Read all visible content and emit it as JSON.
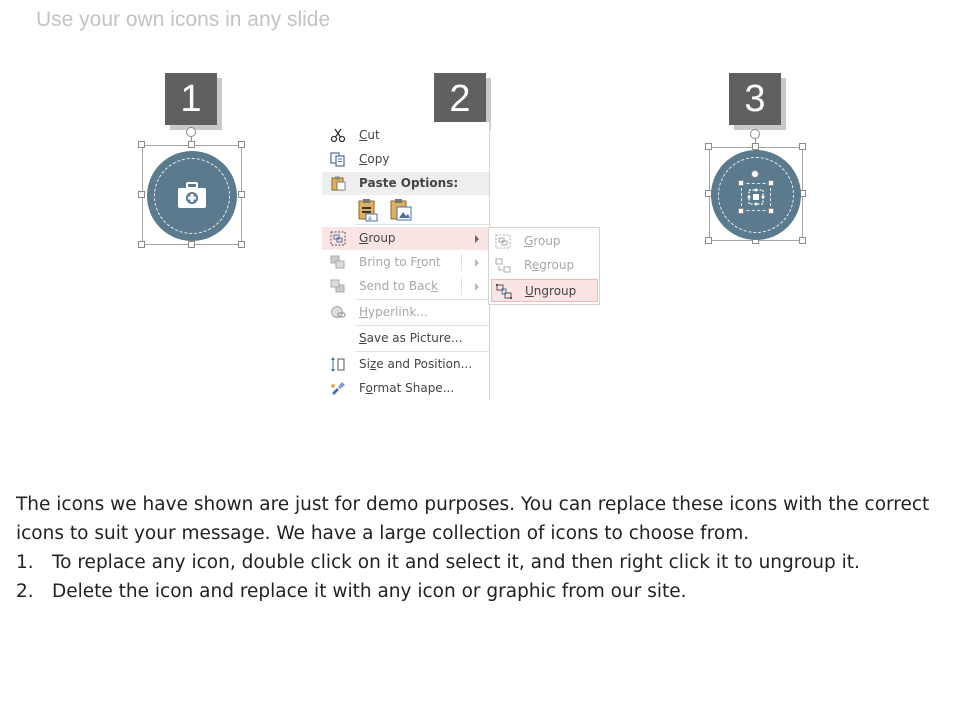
{
  "slide": {
    "title": "Use your own icons in any slide"
  },
  "steps": [
    {
      "number": "1"
    },
    {
      "number": "2"
    },
    {
      "number": "3"
    }
  ],
  "context_menu": {
    "items": [
      {
        "key": "cut",
        "label_pre": "",
        "label_u": "C",
        "label_post": "ut",
        "icon": "scissors-icon"
      },
      {
        "key": "copy",
        "label_pre": "",
        "label_u": "C",
        "label_post": "opy",
        "icon": "copy-icon"
      },
      {
        "key": "paste_options",
        "label": "Paste Options:",
        "icon": "clipboard-icon"
      },
      {
        "key": "group",
        "label_pre": "",
        "label_u": "G",
        "label_post": "roup",
        "icon": "group-icon"
      },
      {
        "key": "bring_to_front",
        "label_pre": "Bring to F",
        "label_u": "r",
        "label_post": "ont",
        "icon": "bring-to-front-icon"
      },
      {
        "key": "send_to_back",
        "label_pre": "Send to Bac",
        "label_u": "k",
        "label_post": "",
        "icon": "send-to-back-icon"
      },
      {
        "key": "hyperlink",
        "label_pre": "",
        "label_u": "H",
        "label_post": "yperlink...",
        "icon": "hyperlink-icon"
      },
      {
        "key": "save_as_picture",
        "label_pre": "",
        "label_u": "S",
        "label_post": "ave as Picture...",
        "icon": ""
      },
      {
        "key": "size_and_position",
        "label_pre": "Si",
        "label_u": "z",
        "label_post": "e and Position...",
        "icon": "size-position-icon"
      },
      {
        "key": "format_shape",
        "label_pre": "F",
        "label_u": "o",
        "label_post": "rmat Shape...",
        "icon": "format-shape-icon"
      }
    ]
  },
  "submenu": {
    "items": [
      {
        "key": "group",
        "label_pre": "",
        "label_u": "G",
        "label_post": "roup"
      },
      {
        "key": "regroup",
        "label_pre": "R",
        "label_u": "e",
        "label_post": "group"
      },
      {
        "key": "ungroup",
        "label_pre": "",
        "label_u": "U",
        "label_post": "ngroup"
      }
    ]
  },
  "instructions": {
    "intro": "The icons we have shown are just for demo purposes. You can replace these icons with the correct icons to suit your message. We have a large collection of icons to choose from.",
    "list": [
      {
        "num": "1.",
        "text": "To replace any icon, double click on it and select it, and then right click it to ungroup it."
      },
      {
        "num": "2.",
        "text": "Delete the icon and replace it with any icon or graphic from our site."
      }
    ]
  },
  "colors": {
    "badge": "#5f6062",
    "circle": "#5b7a8e",
    "menu_highlight": "#fbe4e4"
  }
}
